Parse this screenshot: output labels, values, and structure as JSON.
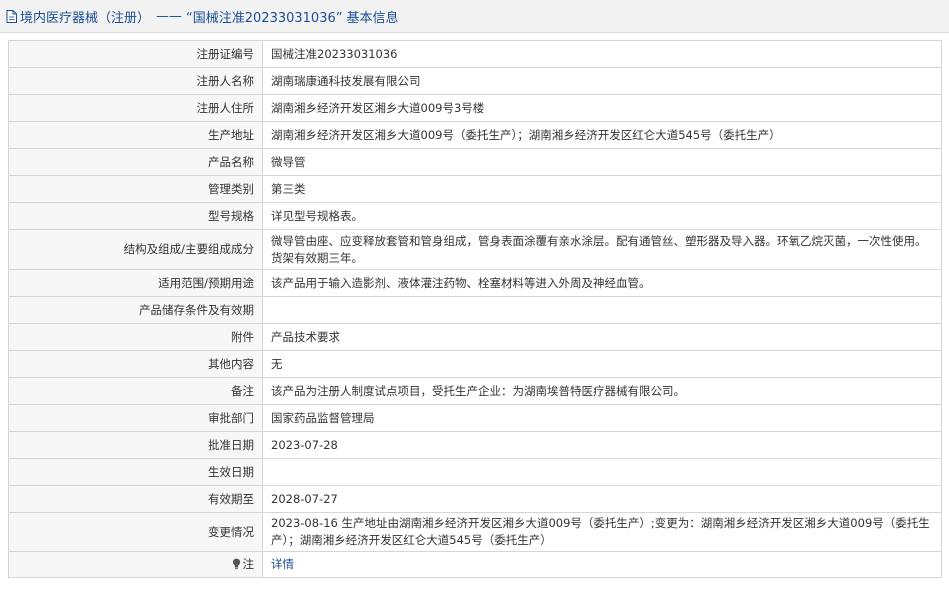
{
  "header": {
    "category": "境内医疗器械（注册）",
    "separator": "——",
    "cert_quoted": "“国械注准20233031036”",
    "suffix": "基本信息"
  },
  "rows": [
    {
      "label": "注册证编号",
      "value": "国械注准20233031036"
    },
    {
      "label": "注册人名称",
      "value": "湖南瑞康通科技发展有限公司"
    },
    {
      "label": "注册人住所",
      "value": "湖南湘乡经济开发区湘乡大道009号3号楼"
    },
    {
      "label": "生产地址",
      "value": "湖南湘乡经济开发区湘乡大道009号（委托生产）；湖南湘乡经济开发区红仑大道545号（委托生产）"
    },
    {
      "label": "产品名称",
      "value": "微导管"
    },
    {
      "label": "管理类别",
      "value": "第三类"
    },
    {
      "label": "型号规格",
      "value": "详见型号规格表。"
    },
    {
      "label": "结构及组成/主要组成成分",
      "value": "微导管由座、应变释放套管和管身组成，管身表面涂覆有亲水涂层。配有通管丝、塑形器及导入器。环氧乙烷灭菌，一次性使用。货架有效期三年。"
    },
    {
      "label": "适用范围/预期用途",
      "value": "该产品用于输入造影剂、液体灌注药物、栓塞材料等进入外周及神经血管。"
    },
    {
      "label": "产品储存条件及有效期",
      "value": ""
    },
    {
      "label": "附件",
      "value": "产品技术要求"
    },
    {
      "label": "其他内容",
      "value": "无"
    },
    {
      "label": "备注",
      "value": "该产品为注册人制度试点项目，受托生产企业：为湖南埃普特医疗器械有限公司。"
    },
    {
      "label": "审批部门",
      "value": "国家药品监督管理局"
    },
    {
      "label": "批准日期",
      "value": "2023-07-28"
    },
    {
      "label": "生效日期",
      "value": ""
    },
    {
      "label": "有效期至",
      "value": "2028-07-27"
    },
    {
      "label": "变更情况",
      "value": "2023-08-16 生产地址由湖南湘乡经济开发区湘乡大道009号（委托生产）;变更为：湖南湘乡经济开发区湘乡大道009号（委托生产）；湖南湘乡经济开发区红仑大道545号（委托生产）"
    }
  ],
  "note_row": {
    "label": "注",
    "value": "详情"
  },
  "colors": {
    "link": "#1a4f97",
    "label_bg": "#f7f7f7",
    "header_bg": "#f2f2f2",
    "border": "#d6d6d6"
  },
  "icons": {
    "header": "document-icon",
    "note": "lightbulb-icon"
  }
}
